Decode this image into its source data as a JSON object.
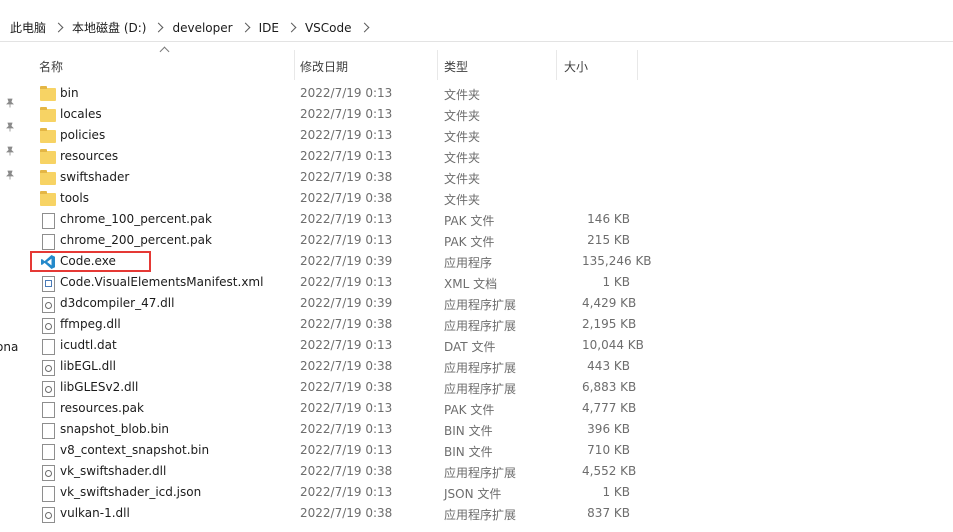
{
  "breadcrumb": [
    "此电脑",
    "本地磁盘 (D:)",
    "developer",
    "IDE",
    "VSCode"
  ],
  "left_cut_text": "ona",
  "columns": {
    "name": "名称",
    "date": "修改日期",
    "type": "类型",
    "size": "大小"
  },
  "files": [
    {
      "name": "bin",
      "date": "2022/7/19 0:13",
      "type": "文件夹",
      "size": "",
      "icon": "folder-icon"
    },
    {
      "name": "locales",
      "date": "2022/7/19 0:13",
      "type": "文件夹",
      "size": "",
      "icon": "folder-icon"
    },
    {
      "name": "policies",
      "date": "2022/7/19 0:13",
      "type": "文件夹",
      "size": "",
      "icon": "folder-icon"
    },
    {
      "name": "resources",
      "date": "2022/7/19 0:13",
      "type": "文件夹",
      "size": "",
      "icon": "folder-icon"
    },
    {
      "name": "swiftshader",
      "date": "2022/7/19 0:38",
      "type": "文件夹",
      "size": "",
      "icon": "folder-icon"
    },
    {
      "name": "tools",
      "date": "2022/7/19 0:38",
      "type": "文件夹",
      "size": "",
      "icon": "folder-icon"
    },
    {
      "name": "chrome_100_percent.pak",
      "date": "2022/7/19 0:13",
      "type": "PAK 文件",
      "size": "146 KB",
      "icon": "file-icon"
    },
    {
      "name": "chrome_200_percent.pak",
      "date": "2022/7/19 0:13",
      "type": "PAK 文件",
      "size": "215 KB",
      "icon": "file-icon"
    },
    {
      "name": "Code.exe",
      "date": "2022/7/19 0:39",
      "type": "应用程序",
      "size": "135,246 KB",
      "icon": "vscode-icon"
    },
    {
      "name": "Code.VisualElementsManifest.xml",
      "date": "2022/7/19 0:13",
      "type": "XML 文档",
      "size": "1 KB",
      "icon": "xml-file-icon"
    },
    {
      "name": "d3dcompiler_47.dll",
      "date": "2022/7/19 0:39",
      "type": "应用程序扩展",
      "size": "4,429 KB",
      "icon": "dll-icon"
    },
    {
      "name": "ffmpeg.dll",
      "date": "2022/7/19 0:38",
      "type": "应用程序扩展",
      "size": "2,195 KB",
      "icon": "dll-icon"
    },
    {
      "name": "icudtl.dat",
      "date": "2022/7/19 0:13",
      "type": "DAT 文件",
      "size": "10,044 KB",
      "icon": "file-icon"
    },
    {
      "name": "libEGL.dll",
      "date": "2022/7/19 0:38",
      "type": "应用程序扩展",
      "size": "443 KB",
      "icon": "dll-icon"
    },
    {
      "name": "libGLESv2.dll",
      "date": "2022/7/19 0:38",
      "type": "应用程序扩展",
      "size": "6,883 KB",
      "icon": "dll-icon"
    },
    {
      "name": "resources.pak",
      "date": "2022/7/19 0:13",
      "type": "PAK 文件",
      "size": "4,777 KB",
      "icon": "file-icon"
    },
    {
      "name": "snapshot_blob.bin",
      "date": "2022/7/19 0:13",
      "type": "BIN 文件",
      "size": "396 KB",
      "icon": "file-icon"
    },
    {
      "name": "v8_context_snapshot.bin",
      "date": "2022/7/19 0:13",
      "type": "BIN 文件",
      "size": "710 KB",
      "icon": "file-icon"
    },
    {
      "name": "vk_swiftshader.dll",
      "date": "2022/7/19 0:38",
      "type": "应用程序扩展",
      "size": "4,552 KB",
      "icon": "dll-icon"
    },
    {
      "name": "vk_swiftshader_icd.json",
      "date": "2022/7/19 0:13",
      "type": "JSON 文件",
      "size": "1 KB",
      "icon": "file-icon"
    },
    {
      "name": "vulkan-1.dll",
      "date": "2022/7/19 0:38",
      "type": "应用程序扩展",
      "size": "837 KB",
      "icon": "dll-icon"
    }
  ],
  "colors": {
    "highlight": "#e53935",
    "folder": "#f7d364",
    "vscode_blue": "#2489ca"
  }
}
